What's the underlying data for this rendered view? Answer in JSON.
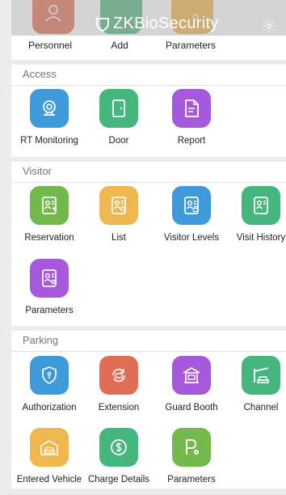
{
  "header": {
    "brand": "ZKBioSecurity",
    "top_items": [
      {
        "label": "Personnel",
        "color": "#e2735b",
        "icon": "person-icon"
      },
      {
        "label": "Add",
        "color": "#59b984",
        "icon": "add-icon"
      },
      {
        "label": "Parameters",
        "color": "#f0b74f",
        "icon": "parameters-icon"
      }
    ]
  },
  "sections": {
    "access": {
      "title": "Access",
      "items": [
        {
          "label": "RT Monitoring",
          "color": "#3e9ad8",
          "icon": "camera-icon"
        },
        {
          "label": "Door",
          "color": "#46b67f",
          "icon": "door-icon"
        },
        {
          "label": "Report",
          "color": "#a55add",
          "icon": "report-icon"
        }
      ]
    },
    "visitor": {
      "title": "Visitor",
      "items": [
        {
          "label": "Reservation",
          "color": "#74b94b",
          "icon": "reservation-icon"
        },
        {
          "label": "List",
          "color": "#f0b750",
          "icon": "list-icon"
        },
        {
          "label": "Visitor Levels",
          "color": "#3e9ad8",
          "icon": "visitor-levels-icon"
        },
        {
          "label": "Visit History",
          "color": "#46b67f",
          "icon": "visit-history-icon"
        },
        {
          "label": "Parameters",
          "color": "#a55add",
          "icon": "visitor-parameters-icon"
        }
      ]
    },
    "parking": {
      "title": "Parking",
      "items": [
        {
          "label": "Authorization",
          "color": "#3e9ad8",
          "icon": "authorization-icon"
        },
        {
          "label": "Extension",
          "color": "#e26d55",
          "icon": "extension-icon"
        },
        {
          "label": "Guard Booth",
          "color": "#a55add",
          "icon": "guard-booth-icon"
        },
        {
          "label": "Channel",
          "color": "#46b67f",
          "icon": "channel-icon"
        },
        {
          "label": "Entered Vehicle",
          "color": "#f0b74f",
          "icon": "entered-vehicle-icon"
        },
        {
          "label": "Charge Details",
          "color": "#46b67f",
          "icon": "charge-details-icon"
        },
        {
          "label": "Parameters",
          "color": "#74b94b",
          "icon": "parking-parameters-icon"
        }
      ]
    }
  }
}
